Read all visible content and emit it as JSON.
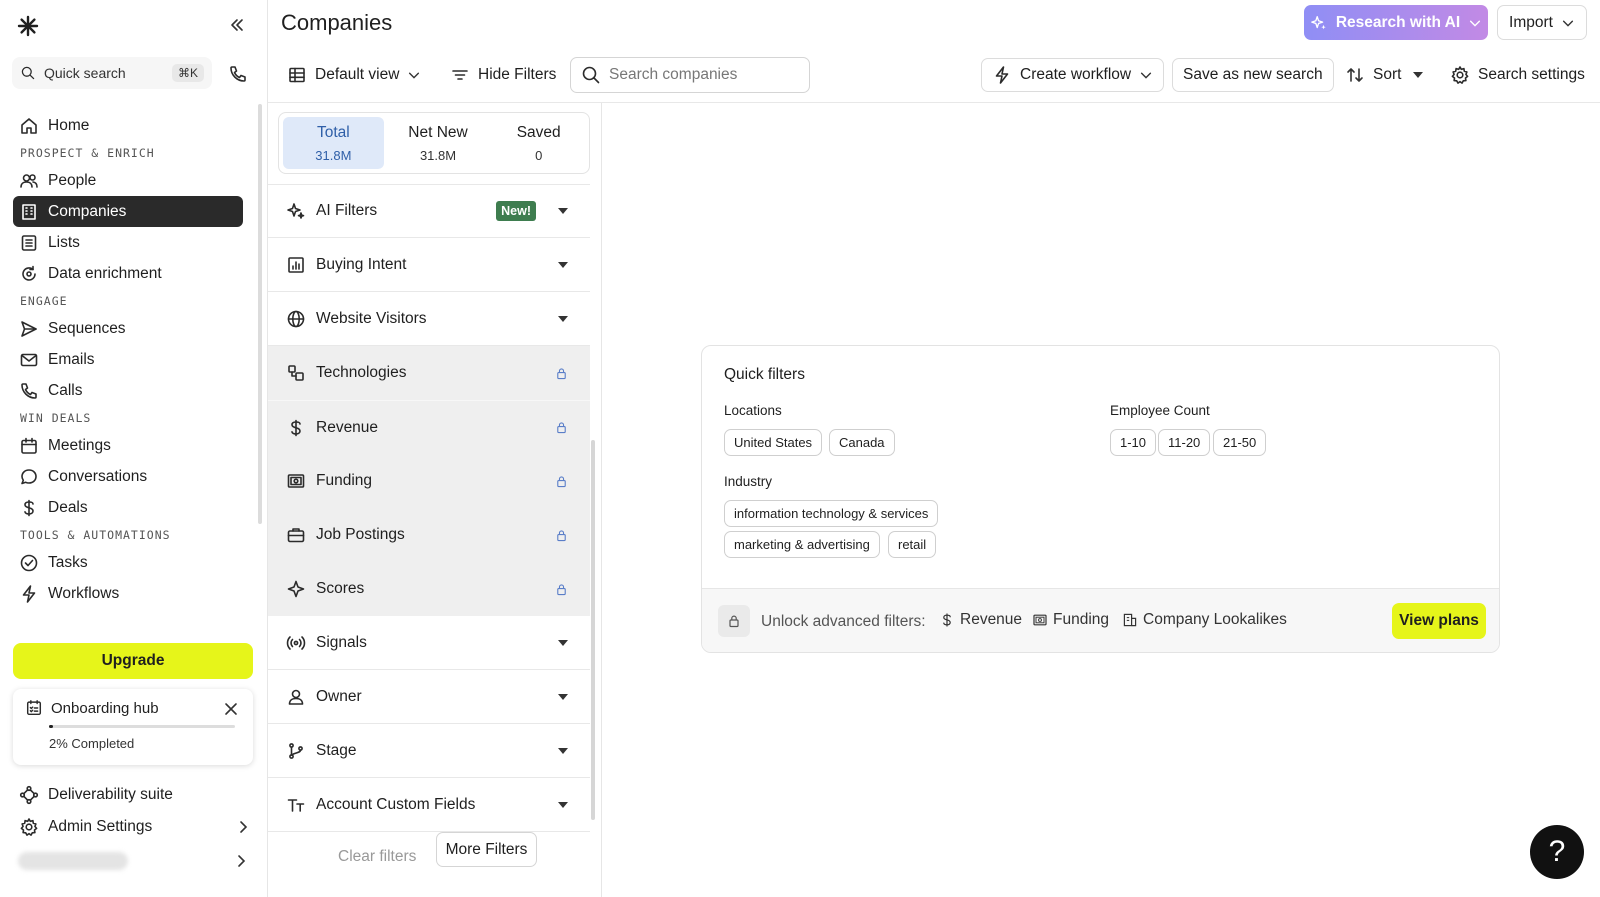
{
  "app": {
    "page_title": "Companies"
  },
  "sidebar": {
    "quick_search": "Quick search",
    "quick_search_kbd": "⌘K",
    "home": "Home",
    "sections": {
      "prospect": "PROSPECT & ENRICH",
      "engage": "ENGAGE",
      "win": "WIN DEALS",
      "tools": "TOOLS & AUTOMATIONS"
    },
    "items": {
      "people": "People",
      "companies": "Companies",
      "lists": "Lists",
      "data_enrichment": "Data enrichment",
      "sequences": "Sequences",
      "emails": "Emails",
      "calls": "Calls",
      "meetings": "Meetings",
      "conversations": "Conversations",
      "deals": "Deals",
      "tasks": "Tasks",
      "workflows": "Workflows"
    },
    "upgrade": "Upgrade",
    "onboarding": {
      "title": "Onboarding hub",
      "completed": "2% Completed",
      "progress": 0.02
    },
    "deliverability": "Deliverability suite",
    "admin_settings": "Admin Settings"
  },
  "header": {
    "research": "Research with AI",
    "import": "Import"
  },
  "toolbar": {
    "default_view": "Default view",
    "hide_filters": "Hide Filters",
    "search_placeholder": "Search companies",
    "create_workflow": "Create workflow",
    "save_search": "Save as new search",
    "sort": "Sort",
    "search_settings": "Search settings"
  },
  "counts": [
    {
      "label": "Total",
      "value": "31.8M"
    },
    {
      "label": "Net New",
      "value": "31.8M"
    },
    {
      "label": "Saved",
      "value": "0"
    }
  ],
  "filters": {
    "ai_filters": "AI Filters",
    "new_badge": "New!",
    "buying_intent": "Buying Intent",
    "website_visitors": "Website Visitors",
    "technologies": "Technologies",
    "revenue": "Revenue",
    "funding": "Funding",
    "job_postings": "Job Postings",
    "scores": "Scores",
    "signals": "Signals",
    "owner": "Owner",
    "stage": "Stage",
    "custom_fields": "Account Custom Fields",
    "clear": "Clear filters",
    "more": "More Filters"
  },
  "quick_filters": {
    "title": "Quick filters",
    "locations_label": "Locations",
    "locations": [
      "United States",
      "Canada"
    ],
    "employee_label": "Employee Count",
    "employee": [
      "1-10",
      "11-20",
      "21-50"
    ],
    "industry_label": "Industry",
    "industry": [
      "information technology & services",
      "marketing & advertising",
      "retail"
    ],
    "unlock_text": "Unlock advanced filters:",
    "unlock_items": [
      "Revenue",
      "Funding",
      "Company Lookalikes"
    ],
    "view_plans": "View plans"
  },
  "help": "?"
}
